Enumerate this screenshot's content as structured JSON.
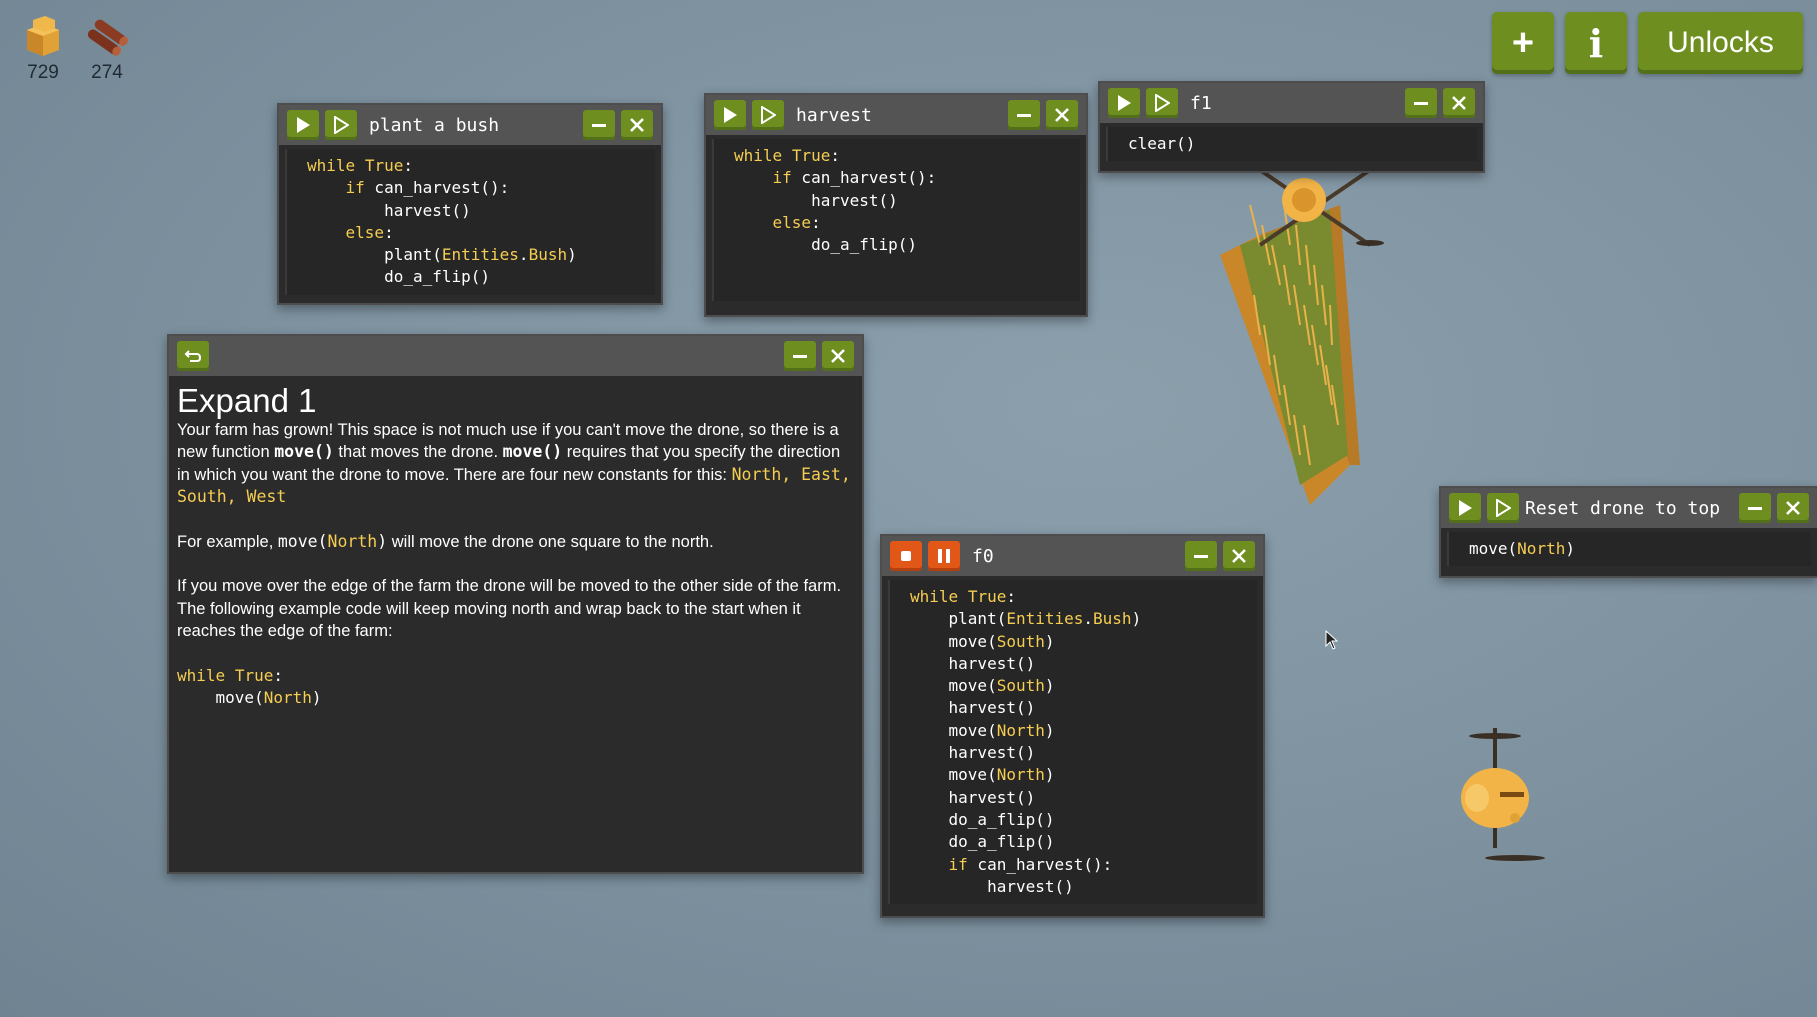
{
  "resources": [
    {
      "icon": "hay-bale-icon",
      "count": "729"
    },
    {
      "icon": "wood-logs-icon",
      "count": "274"
    }
  ],
  "top_buttons": {
    "add_label": "+",
    "info_label": "i",
    "unlocks_label": "Unlocks"
  },
  "windows": {
    "plant_a_bush": {
      "title": "plant a bush",
      "code": [
        "while True:",
        "    if can_harvest():",
        "        harvest()",
        "    else:",
        "        plant(Entities.Bush)",
        "        do_a_flip()"
      ]
    },
    "harvest": {
      "title": "harvest",
      "code": [
        "while True:",
        "    if can_harvest():",
        "        harvest()",
        "    else:",
        "        do_a_flip()"
      ]
    },
    "f1": {
      "title": "f1",
      "code": [
        "clear()"
      ]
    },
    "reset": {
      "title": "Reset drone to top",
      "code": [
        "move(North)"
      ]
    },
    "f0": {
      "title": "f0",
      "running": true,
      "code": [
        "while True:",
        "    plant(Entities.Bush)",
        "    move(South)",
        "    harvest()",
        "    move(South)",
        "    harvest()",
        "    move(North)",
        "    harvest()",
        "    move(North)",
        "    harvest()",
        "    do_a_flip()",
        "    do_a_flip()",
        "    if can_harvest():",
        "        harvest()"
      ]
    },
    "info": {
      "heading": "Expand 1",
      "p1_a": "Your farm has grown! This space is not much use if you can't move the drone, so there is a new function ",
      "p1_move1": "move()",
      "p1_b": " that moves the drone. ",
      "p1_move2": "move()",
      "p1_c": " requires that you specify the direction in which you want the drone to move. There are four new constants for this: ",
      "p1_consts": "North, East, South, West",
      "p2_a": "For example, ",
      "p2_code_fn": "move(",
      "p2_code_arg": "North",
      "p2_code_end": ")",
      "p2_b": " will move the drone one square to the north.",
      "p3": "If you move over the edge of the farm the drone will be moved to the other side of the farm.",
      "p4": "The following example code will keep moving north and wrap back to the start when it reaches the edge of the farm:",
      "code": [
        "while True:",
        "    move(North)"
      ]
    }
  },
  "colors": {
    "accent_green": "#6e8e1f",
    "stop_orange": "#e05718",
    "keyword_yellow": "#f5cd52",
    "window_bg": "#2b2b2b"
  }
}
